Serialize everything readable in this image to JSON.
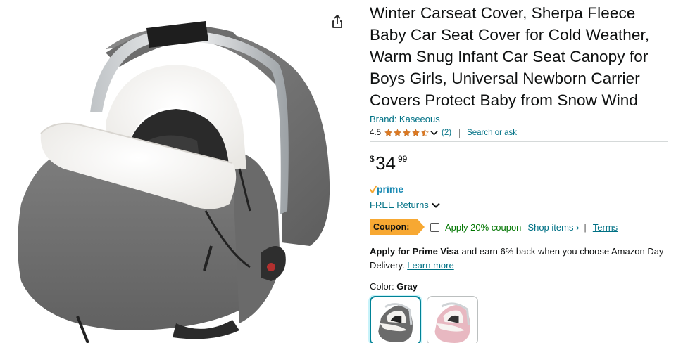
{
  "product": {
    "title": "Winter Carseat Cover, Sherpa Fleece Baby Car Seat Cover for Cold Weather, Warm Snug Infant Car Seat Canopy for Boys Girls, Universal Newborn Carrier Covers Protect Baby from Snow Wind",
    "brand": "Brand: Kaseeous",
    "rating_value": "4.5",
    "rating_stars": 4.5,
    "rating_count": "(2)",
    "search_ask": "Search or ask"
  },
  "price": {
    "currency": "$",
    "whole": "34",
    "fraction": "99"
  },
  "shipping": {
    "prime_label": "prime",
    "returns": "FREE Returns"
  },
  "coupon": {
    "badge": "Coupon:",
    "text": "Apply 20% coupon",
    "shop_items": "Shop items ›",
    "separator": "|",
    "terms": "Terms"
  },
  "visa": {
    "bold": "Apply for Prime Visa",
    "text": " and earn 6% back when you choose Amazon Day Delivery. ",
    "link": "Learn more"
  },
  "color": {
    "label": "Color: ",
    "selected": "Gray",
    "options": [
      "Gray",
      "Pink"
    ]
  },
  "colors": {
    "link": "#007185",
    "coupon": "#f7a832",
    "coupon_text": "#007600",
    "star": "#de7921",
    "swatch_selected": "#008296"
  },
  "icons": {
    "share": "share-icon",
    "stars": "star-icon",
    "dropdown": "chevron-down-icon"
  }
}
